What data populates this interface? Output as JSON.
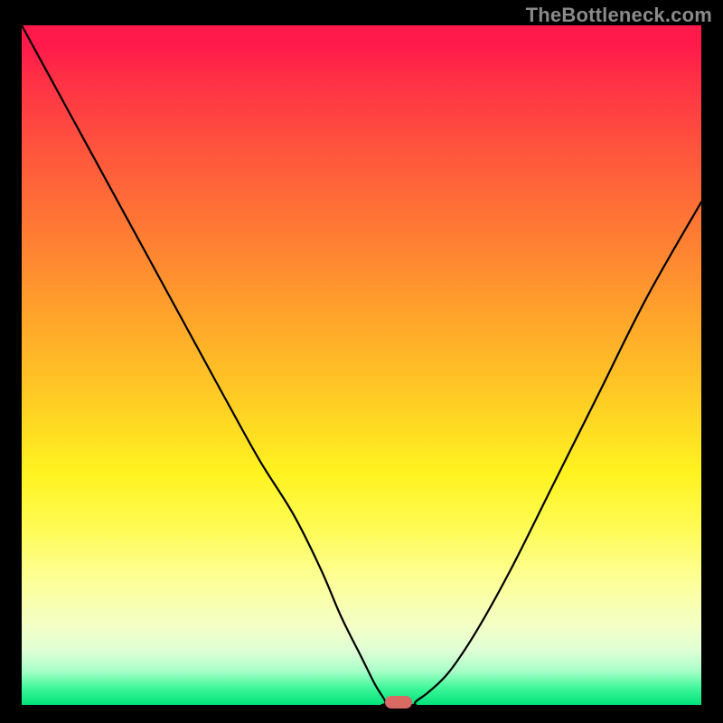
{
  "watermark": "TheBottleneck.com",
  "colors": {
    "frame": "#000000",
    "marker": "#d96a63",
    "curve": "#000000"
  },
  "chart_data": {
    "type": "line",
    "title": "",
    "xlabel": "",
    "ylabel": "",
    "xlim": [
      0,
      100
    ],
    "ylim": [
      0,
      100
    ],
    "grid": false,
    "legend": false,
    "optimal": {
      "x": 55.5,
      "y": 0,
      "flat_width": 5
    },
    "series": [
      {
        "name": "left-branch",
        "x": [
          0,
          6,
          12,
          18,
          24,
          30,
          35,
          40,
          44,
          47,
          50,
          52,
          53.5
        ],
        "values": [
          100,
          89,
          78,
          67,
          56,
          45,
          36,
          28,
          20,
          13,
          7,
          3,
          0.5
        ]
      },
      {
        "name": "right-branch",
        "x": [
          58,
          60,
          63,
          67,
          72,
          78,
          85,
          92,
          100
        ],
        "values": [
          0.5,
          2,
          5,
          11,
          20,
          32,
          46,
          60,
          74
        ]
      }
    ],
    "annotations": []
  }
}
